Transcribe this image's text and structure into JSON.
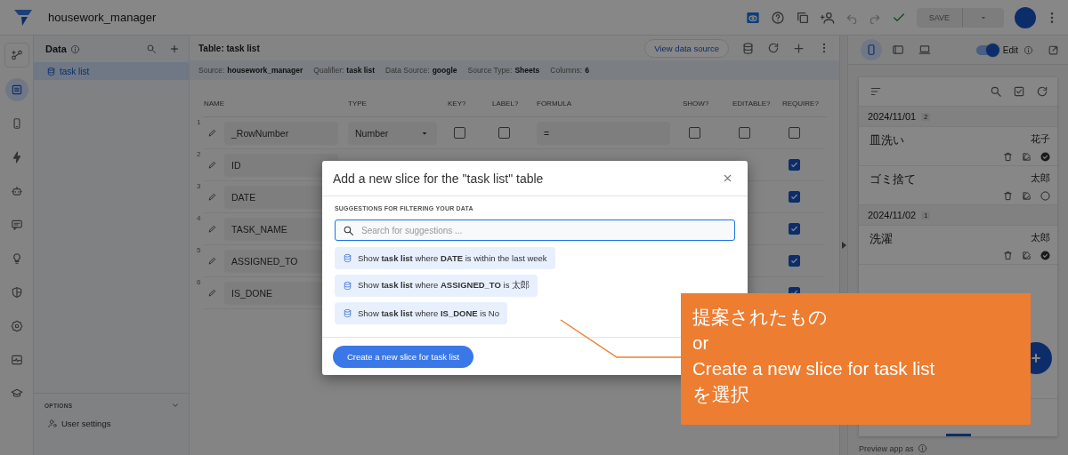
{
  "app": {
    "title": "housework_manager"
  },
  "toolbar": {
    "save": {
      "label": "SAVE",
      "disabled": true
    }
  },
  "rail": [
    {
      "kind": "flows",
      "selected": false
    },
    {
      "kind": "data",
      "selected": true
    },
    {
      "kind": "views",
      "selected": false
    },
    {
      "kind": "actions",
      "selected": false
    },
    {
      "kind": "bot",
      "selected": false
    },
    {
      "kind": "chat",
      "selected": false
    },
    {
      "kind": "ideas",
      "selected": false
    },
    {
      "kind": "security",
      "selected": false
    },
    {
      "kind": "settings",
      "selected": false
    },
    {
      "kind": "monitor",
      "selected": false
    },
    {
      "kind": "learn",
      "selected": false
    }
  ],
  "data_panel": {
    "title": "Data",
    "tables": [
      {
        "label": "task list",
        "selected": true
      }
    ],
    "options_label": "OPTIONS",
    "options": [
      {
        "label": "User settings"
      }
    ]
  },
  "table_panel": {
    "title": "Table: task list",
    "view_button": "View data source",
    "meta": [
      {
        "key": "Source:",
        "value": "housework_manager"
      },
      {
        "key": "Qualifier:",
        "value": "task list"
      },
      {
        "key": "Data Source:",
        "value": "google"
      },
      {
        "key": "Source Type:",
        "value": "Sheets"
      },
      {
        "key": "Columns:",
        "value": "6"
      }
    ],
    "columns": [
      "NAME",
      "TYPE",
      "KEY?",
      "LABEL?",
      "FORMULA",
      "SHOW?",
      "EDITABLE?",
      "REQUIRE?"
    ],
    "rows": [
      {
        "index": "1",
        "name": "_RowNumber",
        "type": "Number",
        "key": false,
        "label": false,
        "formula": "=",
        "show": false,
        "editable": false,
        "require": false
      },
      {
        "index": "2",
        "name": "ID",
        "require": true
      },
      {
        "index": "3",
        "name": "DATE",
        "require": true
      },
      {
        "index": "4",
        "name": "TASK_NAME",
        "require": true
      },
      {
        "index": "5",
        "name": "ASSIGNED_TO",
        "require": true
      },
      {
        "index": "6",
        "name": "IS_DONE",
        "require": true
      }
    ]
  },
  "preview": {
    "devices": [
      {
        "kind": "phone",
        "selected": true
      },
      {
        "kind": "tablet",
        "selected": false
      },
      {
        "kind": "desktop",
        "selected": false
      }
    ],
    "edit_label": "Edit",
    "edit_on": true,
    "groups": [
      {
        "date": "2024/11/01",
        "count": "2",
        "items": [
          {
            "title": "皿洗い",
            "assignee": "花子",
            "done": true
          },
          {
            "title": "ゴミ捨て",
            "assignee": "太郎",
            "done": false
          }
        ]
      },
      {
        "date": "2024/11/02",
        "count": "1",
        "items": [
          {
            "title": "洗濯",
            "assignee": "太郎",
            "done": true
          }
        ]
      }
    ],
    "footer": "Preview app as"
  },
  "dialog": {
    "title": "Add a new slice for the \"task list\" table",
    "section": "SUGGESTIONS FOR FILTERING YOUR DATA",
    "search": {
      "placeholder": "Search for suggestions ..."
    },
    "suggestions": [
      "Show **task list** where **DATE** is within the last week",
      "Show **task list** where **ASSIGNED_TO** is 太郎",
      "Show **task list** where **IS_DONE** is No"
    ],
    "create_button": "Create a new slice for task list"
  },
  "annotation": {
    "lines": [
      "提案されたもの",
      "or",
      "Create a new slice for task list",
      "を選択"
    ]
  }
}
